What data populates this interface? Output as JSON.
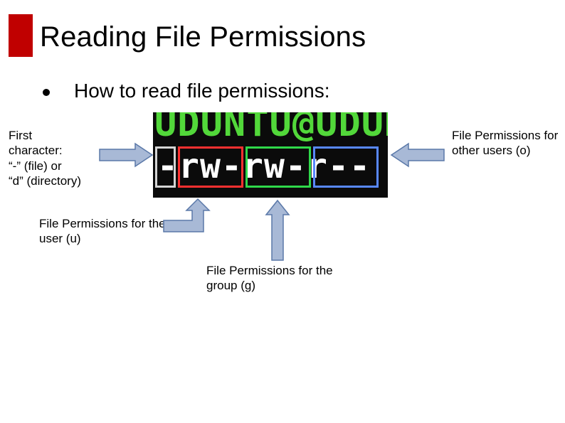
{
  "slide": {
    "title": "Reading File Permissions",
    "bullet": "How to read file permissions:"
  },
  "terminal": {
    "line1": "UDUNTU@UDUN",
    "line2": "-rw-rw-r--"
  },
  "labels": {
    "first_character": "First\ncharacter:\n“-” (file) or\n“d” (directory)",
    "other": "File Permissions for other users (o)",
    "user": "File Permissions for the user (u)",
    "group": "File Permissions for the group (g)"
  }
}
